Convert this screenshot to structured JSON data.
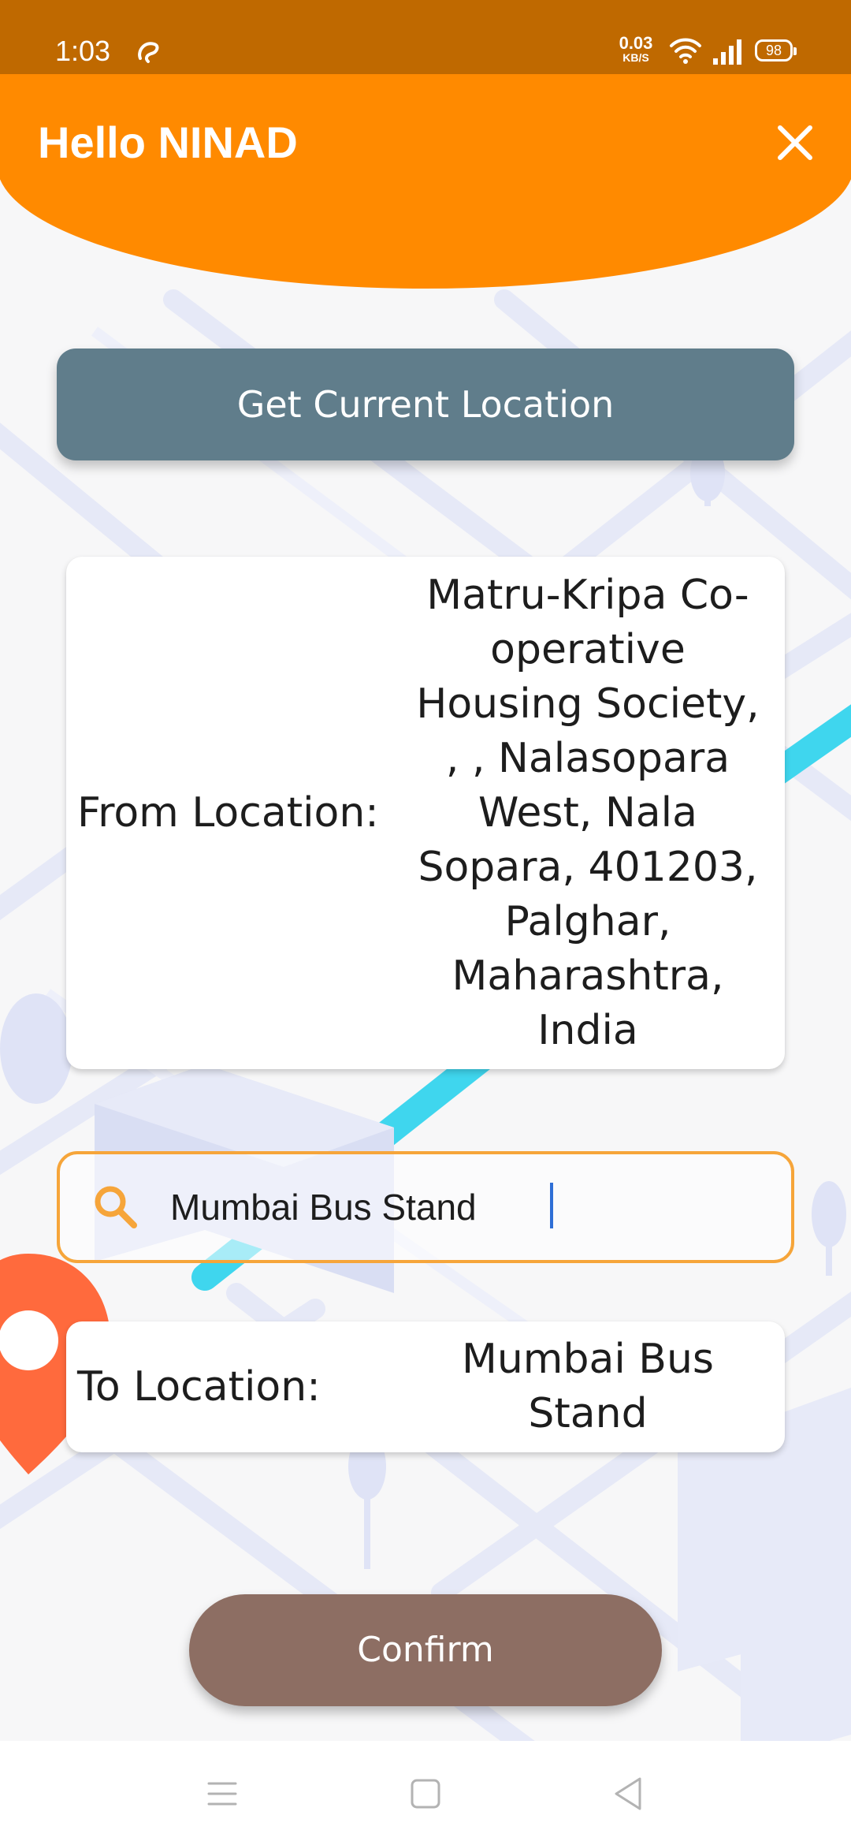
{
  "status_bar": {
    "time": "1:03",
    "net_speed_value": "0.03",
    "net_speed_unit": "KB/S",
    "battery": "98"
  },
  "header": {
    "title": "Hello NINAD",
    "close_icon": "close-icon"
  },
  "actions": {
    "get_location_label": "Get Current Location",
    "confirm_label": "Confirm"
  },
  "from_card": {
    "label": "From Location:",
    "value": "Matru-Kripa Co-operative Housing Society, , , Nalasopara West, Nala Sopara, 401203, Palghar, Maharashtra, India"
  },
  "search": {
    "icon": "search-icon",
    "value": "Mumbai Bus Stand"
  },
  "to_card": {
    "label": "To Location:",
    "value": "Mumbai Bus Stand"
  },
  "colors": {
    "status_bar": "#bf6900",
    "header": "#ff8a00",
    "get_location_button": "#607d8b",
    "confirm_button": "#8d6e63",
    "search_border": "#f6a53a",
    "map_road_accent": "#3fd6ee",
    "map_pin": "#ff6a3d"
  }
}
